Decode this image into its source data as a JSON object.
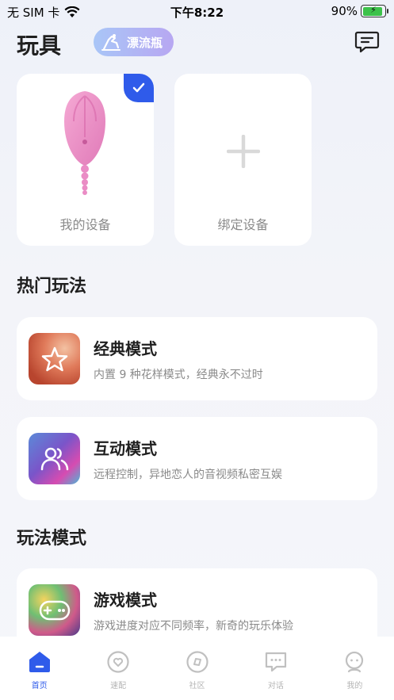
{
  "status_bar": {
    "carrier": "无 SIM 卡",
    "time": "下午8:22",
    "battery_percent": "90%",
    "battery_level": 0.9
  },
  "header": {
    "title": "玩具",
    "bottle_label": "漂流瓶"
  },
  "devices": {
    "my_device_label": "我的设备",
    "bind_device_label": "绑定设备"
  },
  "sections": {
    "hot_title": "热门玩法",
    "play_modes_title": "玩法模式"
  },
  "modes": [
    {
      "title": "经典模式",
      "desc": "内置 9 种花样模式，经典永不过时"
    },
    {
      "title": "互动模式",
      "desc": "远程控制，异地恋人的音视频私密互娱"
    },
    {
      "title": "游戏模式",
      "desc": "游戏进度对应不同频率，新奇的玩乐体验"
    }
  ],
  "tabs": [
    {
      "label": "首页",
      "icon": "home-icon",
      "active": true
    },
    {
      "label": "速配",
      "icon": "match-icon",
      "active": false
    },
    {
      "label": "社区",
      "icon": "community-icon",
      "active": false
    },
    {
      "label": "对话",
      "icon": "chat-icon",
      "active": false
    },
    {
      "label": "我的",
      "icon": "profile-icon",
      "active": false
    }
  ],
  "colors": {
    "accent": "#2f5bea",
    "inactive": "#b5b5b5"
  }
}
